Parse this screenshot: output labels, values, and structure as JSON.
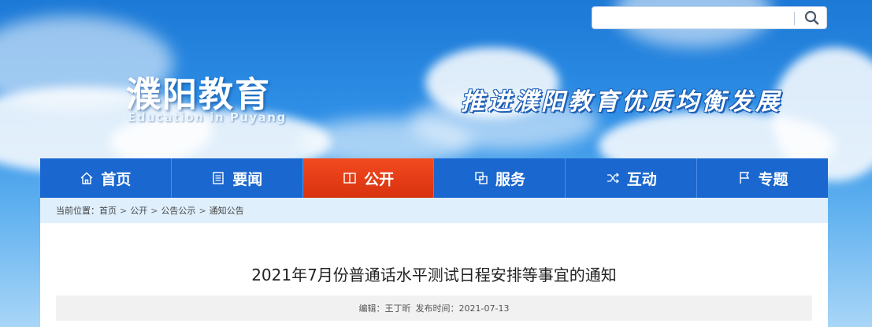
{
  "header": {
    "logo_cn": "濮阳教育",
    "logo_en": "Education in Puyang",
    "slogan": "推进濮阳教育优质均衡发展",
    "search": {
      "value": "",
      "placeholder": ""
    }
  },
  "nav": {
    "items": [
      {
        "label": "首页",
        "icon": "home-icon"
      },
      {
        "label": "要闻",
        "icon": "news-icon"
      },
      {
        "label": "公开",
        "icon": "book-icon",
        "active": true
      },
      {
        "label": "服务",
        "icon": "service-icon"
      },
      {
        "label": "互动",
        "icon": "shuffle-icon"
      },
      {
        "label": "专题",
        "icon": "flag-icon"
      }
    ]
  },
  "breadcrumb": {
    "prefix": "当前位置：",
    "items": [
      "首页",
      "公开",
      "公告公示",
      "通知公告"
    ],
    "separator": ">"
  },
  "article": {
    "title": "2021年7月份普通话水平测试日程安排等事宜的通知",
    "editor_label": "编辑：王丁昕",
    "date_label": "发布时间：2021-07-13"
  },
  "colors": {
    "nav_bg": "#1a67cf",
    "nav_active": "#e53d16",
    "crumb_bg": "#dfeffc",
    "meta_bg": "#f1f1f1"
  }
}
